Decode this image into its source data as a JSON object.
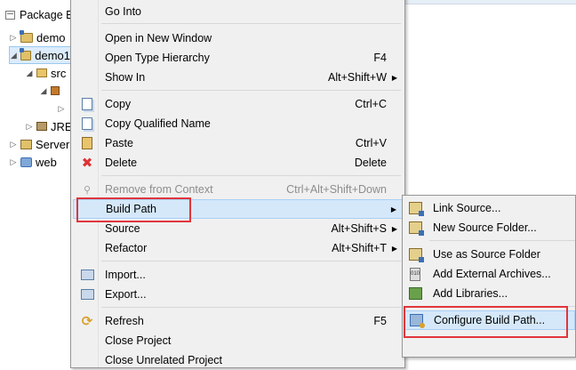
{
  "explorer": {
    "tab_label": "Package E",
    "tree": [
      {
        "label": "demo",
        "twisty": "▷"
      },
      {
        "label": "demo1",
        "twisty": "◢"
      },
      {
        "label": "src",
        "twisty": "◢"
      },
      {
        "label": "",
        "twisty": "◢"
      },
      {
        "label": "",
        "twisty": "▷"
      },
      {
        "label": "JRE",
        "twisty": "▷"
      },
      {
        "label": "Server",
        "twisty": "▷"
      },
      {
        "label": "web",
        "twisty": "▷"
      }
    ]
  },
  "context_menu": {
    "items": [
      {
        "label": "Go Into",
        "accel": ""
      },
      {
        "label": "Open in New Window",
        "accel": ""
      },
      {
        "label": "Open Type Hierarchy",
        "accel": "F4"
      },
      {
        "label": "Show In",
        "accel": "Alt+Shift+W"
      },
      {
        "label": "Copy",
        "accel": "Ctrl+C",
        "icon": "copy-icon"
      },
      {
        "label": "Copy Qualified Name",
        "accel": "",
        "icon": "copy-qualified-icon"
      },
      {
        "label": "Paste",
        "accel": "Ctrl+V",
        "icon": "paste-icon"
      },
      {
        "label": "Delete",
        "accel": "Delete",
        "icon": "delete-icon"
      },
      {
        "label": "Remove from Context",
        "accel": "Ctrl+Alt+Shift+Down",
        "icon": "remove-context-icon"
      },
      {
        "label": "Build Path",
        "accel": ""
      },
      {
        "label": "Source",
        "accel": "Alt+Shift+S"
      },
      {
        "label": "Refactor",
        "accel": "Alt+Shift+T"
      },
      {
        "label": "Import...",
        "accel": "",
        "icon": "import-icon"
      },
      {
        "label": "Export...",
        "accel": "",
        "icon": "export-icon"
      },
      {
        "label": "Refresh",
        "accel": "F5",
        "icon": "refresh-icon"
      },
      {
        "label": "Close Project",
        "accel": ""
      },
      {
        "label": "Close Unrelated Project",
        "accel": ""
      }
    ],
    "submenu_arrow": "▶"
  },
  "build_path_submenu": {
    "items": [
      {
        "label": "Link Source...",
        "icon": "link-source-icon"
      },
      {
        "label": "New Source Folder...",
        "icon": "new-source-folder-icon"
      },
      {
        "label": "Use as Source Folder",
        "icon": "use-source-folder-icon"
      },
      {
        "label": "Add External Archives...",
        "icon": "jar-icon",
        "icon_text": "010"
      },
      {
        "label": "Add Libraries...",
        "icon": "libraries-icon"
      },
      {
        "label": "Configure Build Path...",
        "icon": "configure-build-path-icon"
      }
    ]
  },
  "colors": {
    "menu_bg": "#f0f0f0",
    "highlight": "#d5e8fa",
    "annotation_red": "#e0363c"
  }
}
